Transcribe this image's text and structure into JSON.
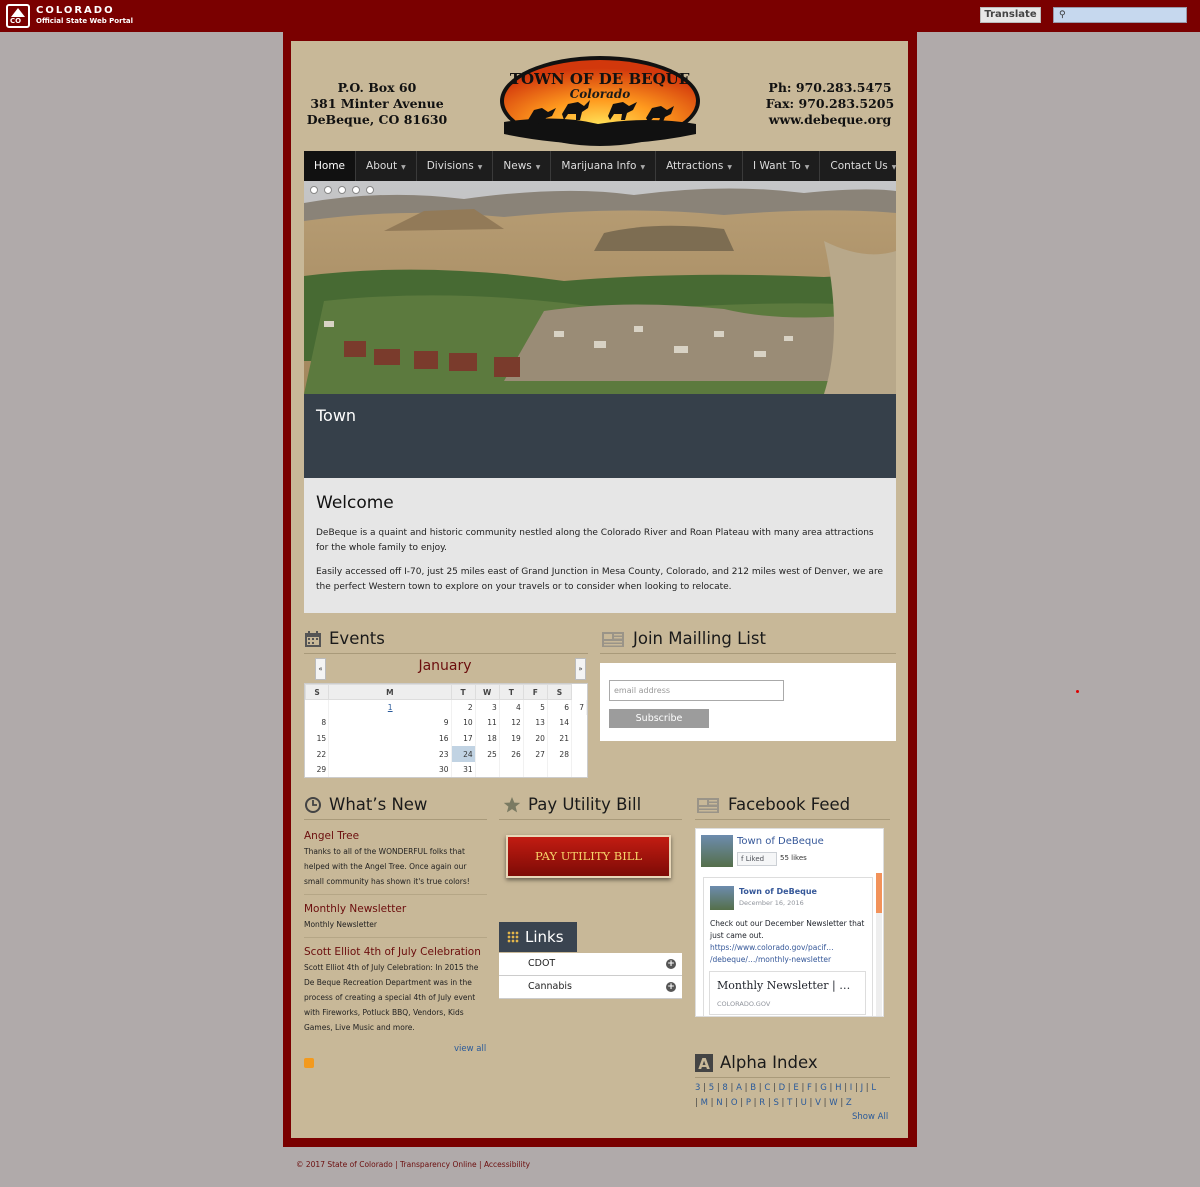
{
  "statebar": {
    "state_name": "COLORADO",
    "portal_name": "Official State Web Portal",
    "translate_label": "Translate",
    "search_placeholder": "",
    "logo_letters": "CO"
  },
  "header": {
    "address_lines": [
      "P.O. Box 60",
      "381 Minter Avenue",
      "DeBeque, CO 81630"
    ],
    "contact_lines": [
      "Ph: 970.283.5475",
      "Fax: 970.283.5205",
      "www.debeque.org"
    ],
    "logo_title": "TOWN OF DE BEQUE",
    "logo_subtitle": "Colorado"
  },
  "nav": {
    "items": [
      {
        "label": "Home",
        "dropdown": false
      },
      {
        "label": "About",
        "dropdown": true
      },
      {
        "label": "Divisions",
        "dropdown": true
      },
      {
        "label": "News",
        "dropdown": true
      },
      {
        "label": "Marijuana Info",
        "dropdown": true
      },
      {
        "label": "Attractions",
        "dropdown": true
      },
      {
        "label": "I Want To",
        "dropdown": true
      },
      {
        "label": "Contact Us",
        "dropdown": true
      }
    ]
  },
  "slider": {
    "caption_title": "Town",
    "slide_count": 5
  },
  "welcome": {
    "title": "Welcome",
    "p1": "DeBeque is a quaint and historic community nestled along the Colorado River and Roan Plateau with many area attractions for the whole family to enjoy.",
    "p2": "Easily accessed off I-70, just 25 miles east of Grand Junction in Mesa County, Colorado, and 212 miles west of Denver, we are the perfect Western town to explore on your travels or to consider when looking to relocate."
  },
  "events": {
    "title": "Events",
    "month": "January",
    "prev_label": "«",
    "next_label": "»",
    "weekdays": [
      "S",
      "M",
      "T",
      "W",
      "T",
      "F",
      "S"
    ],
    "weeks": [
      [
        "",
        "1",
        "2",
        "3",
        "4",
        "5",
        "6",
        "7"
      ],
      [
        "8",
        "9",
        "10",
        "11",
        "12",
        "13",
        "14"
      ],
      [
        "15",
        "16",
        "17",
        "18",
        "19",
        "20",
        "21"
      ],
      [
        "22",
        "23",
        "24",
        "25",
        "26",
        "27",
        "28"
      ],
      [
        "29",
        "30",
        "31",
        "",
        "",
        "",
        ""
      ]
    ],
    "today": "24",
    "linked_day": "1"
  },
  "mailing": {
    "title": "Join Mailling List",
    "email_placeholder": "email address",
    "subscribe_label": "Subscribe"
  },
  "whats_new": {
    "title": "What’s New",
    "items": [
      {
        "title": "Angel Tree",
        "body": "Thanks to all of the WONDERFUL folks that helped with the Angel Tree. Once again our small community has shown it's true colors!"
      },
      {
        "title": "Monthly Newsletter",
        "body": "Monthly Newsletter"
      },
      {
        "title": "Scott Elliot 4th of July Celebration",
        "body": "Scott Elliot 4th of July Celebration: In 2015 the De Beque Recreation Department was in the process of creating a special 4th of July event with Fireworks, Potluck BBQ, Vendors, Kids Games, Live Music and more."
      }
    ],
    "view_all_label": "view all"
  },
  "pay_bill": {
    "title": "Pay Utility Bill",
    "button_label": "PAY UTILITY BILL"
  },
  "links": {
    "title": "Links",
    "items": [
      "CDOT",
      "Cannabis"
    ]
  },
  "facebook": {
    "title": "Facebook Feed",
    "page_name": "Town of DeBeque",
    "liked_label": "Liked",
    "likes_count": "55 likes",
    "post_author": "Town of DeBeque",
    "post_date": "December 16, 2016",
    "post_text": "Check out our December Newsletter that just came out.",
    "post_url": "https://www.colorado.gov/pacif… /debeque/…/monthly-newsletter",
    "card_title": "Monthly Newsletter | …",
    "card_domain": "COLORADO.GOV"
  },
  "alpha_index": {
    "title": "Alpha Index",
    "row1": [
      "3",
      "5",
      "8",
      "A",
      "B",
      "C",
      "D",
      "E",
      "F",
      "G",
      "H",
      "I",
      "J",
      "L"
    ],
    "row2": [
      "M",
      "N",
      "O",
      "P",
      "R",
      "S",
      "T",
      "U",
      "V",
      "W",
      "Z"
    ],
    "show_all_label": "Show All"
  },
  "footer": {
    "copyright": "© 2017 State of Colorado",
    "transparency": "Transparency Online",
    "accessibility": "Accessibility"
  },
  "colors": {
    "brand_red": "#7a0000",
    "panel_tan": "#c8b898",
    "nav_dark": "#1d1d1d",
    "link_blue": "#2a5a9a",
    "title_red": "#6b0d0d"
  }
}
